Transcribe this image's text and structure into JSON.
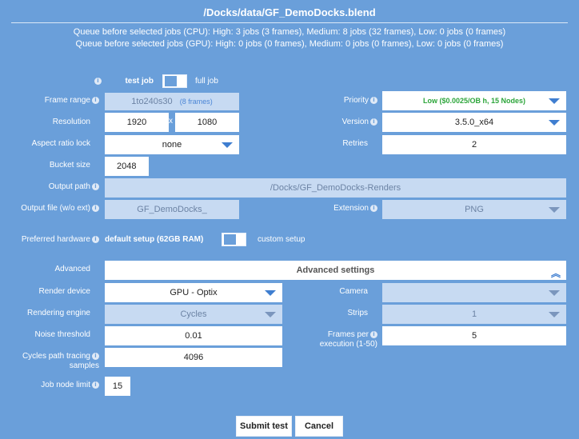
{
  "header": {
    "title": "/Docks/data/GF_DemoDocks.blend"
  },
  "queue": {
    "cpu": "Queue before selected jobs (CPU): High: 3 jobs (3 frames), Medium: 8 jobs (32 frames), Low: 0 jobs (0 frames)",
    "gpu": "Queue before selected jobs (GPU): High: 0 jobs (0 frames), Medium: 0 jobs (0 frames), Low: 0 jobs (0 frames)"
  },
  "job_type": {
    "left": "test job",
    "right": "full job"
  },
  "frame_range": {
    "label": "Frame range",
    "value": "1to240s30",
    "hint": "(8 frames)"
  },
  "priority": {
    "label": "Priority",
    "value": "Low ($0.0025/OB h, 15 Nodes)",
    "color": "#2ca53a"
  },
  "resolution": {
    "label": "Resolution",
    "width": "1920",
    "sep": "x",
    "height": "1080"
  },
  "version": {
    "label": "Version",
    "value": "3.5.0_x64"
  },
  "aspect": {
    "label": "Aspect ratio lock",
    "value": "none"
  },
  "retries": {
    "label": "Retries",
    "value": "2"
  },
  "bucket": {
    "label": "Bucket size",
    "value": "2048"
  },
  "output_path": {
    "label": "Output path",
    "value": "/Docks/GF_DemoDocks-Renders"
  },
  "output_file": {
    "label": "Output file (w/o ext)",
    "value": "GF_DemoDocks_"
  },
  "extension": {
    "label": "Extension",
    "value": "PNG"
  },
  "hardware": {
    "label": "Preferred hardware",
    "left": "default setup (62GB RAM)",
    "right": "custom setup"
  },
  "advanced": {
    "label": "Advanced",
    "header": "Advanced settings"
  },
  "render_device": {
    "label": "Render device",
    "value": "GPU - Optix"
  },
  "camera": {
    "label": "Camera",
    "value": ""
  },
  "engine": {
    "label": "Rendering engine",
    "value": "Cycles"
  },
  "strips": {
    "label": "Strips",
    "value": "1"
  },
  "noise": {
    "label": "Noise threshold",
    "value": "0.01"
  },
  "frames_per_exec": {
    "label_1": "Frames per",
    "label_2": "execution (1-50)",
    "value": "5"
  },
  "samples": {
    "label_1": "Cycles path tracing",
    "label_2": "samples",
    "value": "4096"
  },
  "node_limit": {
    "label": "Job node limit",
    "value": "15"
  },
  "buttons": {
    "submit": "Submit test",
    "cancel": "Cancel"
  },
  "icons": {
    "info": "info-icon",
    "dropdown": "caret-down-icon",
    "collapse": "double-chevron-up-icon"
  },
  "colors": {
    "background": "#6a9fda",
    "accent": "#3f7ed0",
    "disabled": "#c7daf2"
  }
}
